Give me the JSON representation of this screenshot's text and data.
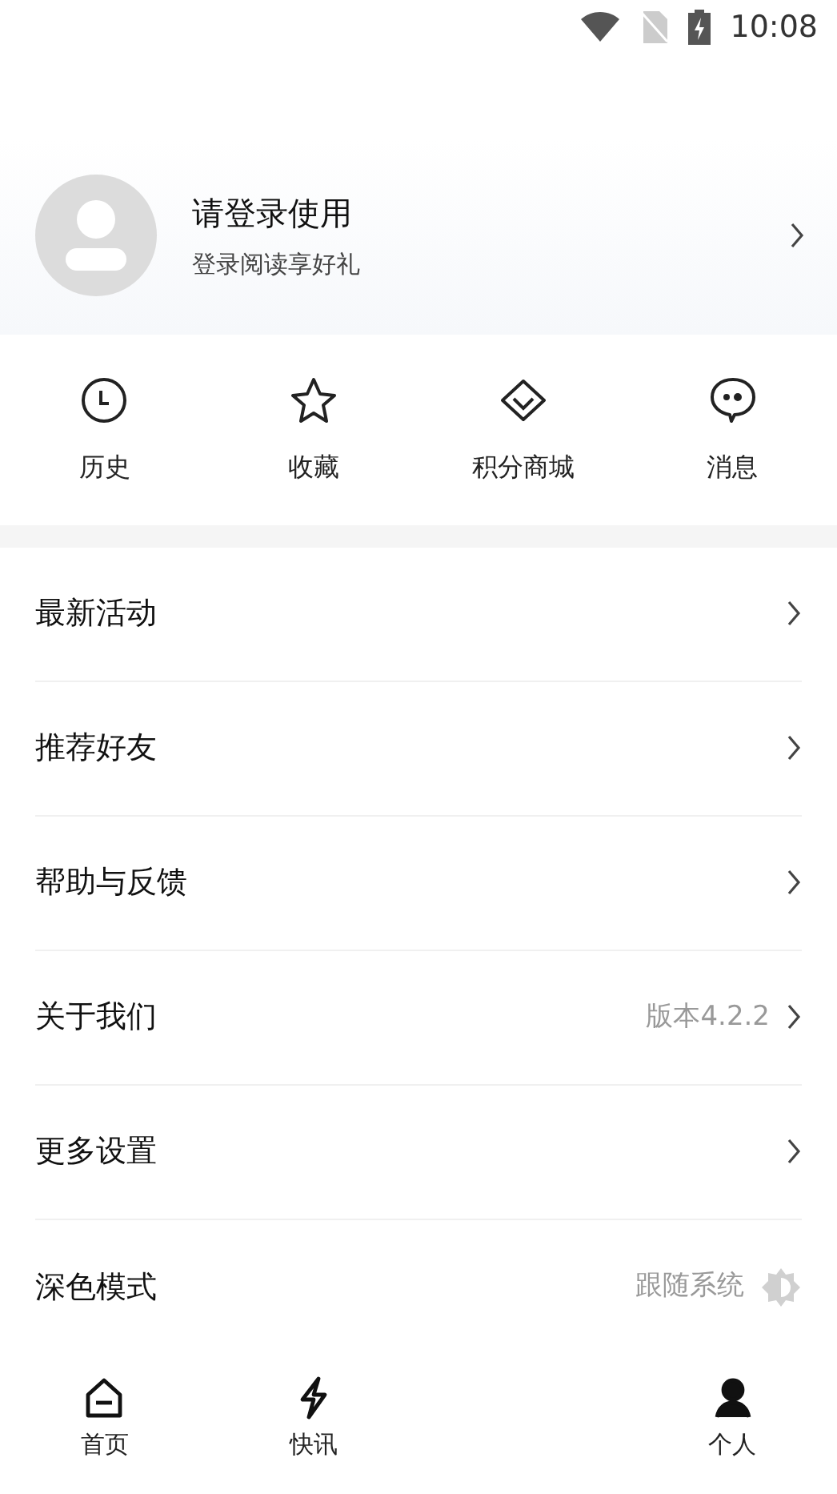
{
  "status_bar": {
    "time": "10:08"
  },
  "profile": {
    "title": "请登录使用",
    "subtitle": "登录阅读享好礼"
  },
  "shortcuts": [
    {
      "label": "历史",
      "kind": "clock"
    },
    {
      "label": "收藏",
      "kind": "star"
    },
    {
      "label": "积分商城",
      "kind": "diamond"
    },
    {
      "label": "消息",
      "kind": "chat"
    }
  ],
  "menu": [
    {
      "label": "最新活动",
      "kind": "link"
    },
    {
      "label": "推荐好友",
      "kind": "link"
    },
    {
      "label": "帮助与反馈",
      "kind": "link"
    },
    {
      "label": "关于我们",
      "kind": "link",
      "value": "版本4.2.2"
    },
    {
      "label": "更多设置",
      "kind": "link"
    },
    {
      "label": "深色模式",
      "kind": "theme",
      "value": "跟随系统"
    }
  ],
  "bottom_nav": [
    {
      "label": "首页",
      "kind": "home"
    },
    {
      "label": "快讯",
      "kind": "bolt"
    },
    {
      "label": "个人",
      "kind": "person"
    }
  ]
}
